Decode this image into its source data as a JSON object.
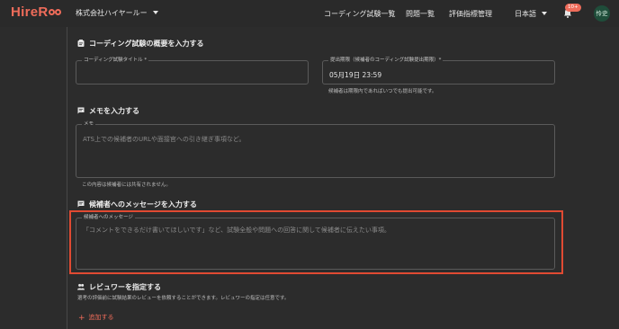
{
  "header": {
    "logo": "HireRoo",
    "company": "株式会社ハイヤールー",
    "nav": [
      "コーディング試験一覧",
      "問題一覧",
      "評価指標管理"
    ],
    "language": "日本語",
    "notification_badge": "10+",
    "avatar_text": "怜史"
  },
  "overview": {
    "title": "コーディング試験の概要を入力する",
    "test_title_label": "コーディング試験タイトル *",
    "test_title_value": "",
    "deadline_label": "提出期限（候補者のコーディング試験提出期限）*",
    "deadline_value": "05月19日 23:59",
    "deadline_hint": "候補者は期限内であればいつでも提出可能です。"
  },
  "memo": {
    "title": "メモを入力する",
    "label": "メモ",
    "placeholder": "ATS上での候補者のURLや面接官への引き継ぎ事項など。",
    "hint": "この内容は候補者には共有されません。"
  },
  "message": {
    "title": "候補者へのメッセージを入力する",
    "label": "候補者へのメッセージ",
    "placeholder": "「コメントをできるだけ書いてほしいです」など、試験全般や問題への回答に関して候補者に伝えたい事項。"
  },
  "reviewer": {
    "title": "レビュワーを指定する",
    "description": "選考の評価前に試験結果のレビューを依頼することができます。レビュワーの指定は任意です。",
    "add_label": "追加する"
  },
  "colors": {
    "accent": "#ef6c5a",
    "highlight": "#e04a32",
    "background": "#2c2c2c"
  }
}
